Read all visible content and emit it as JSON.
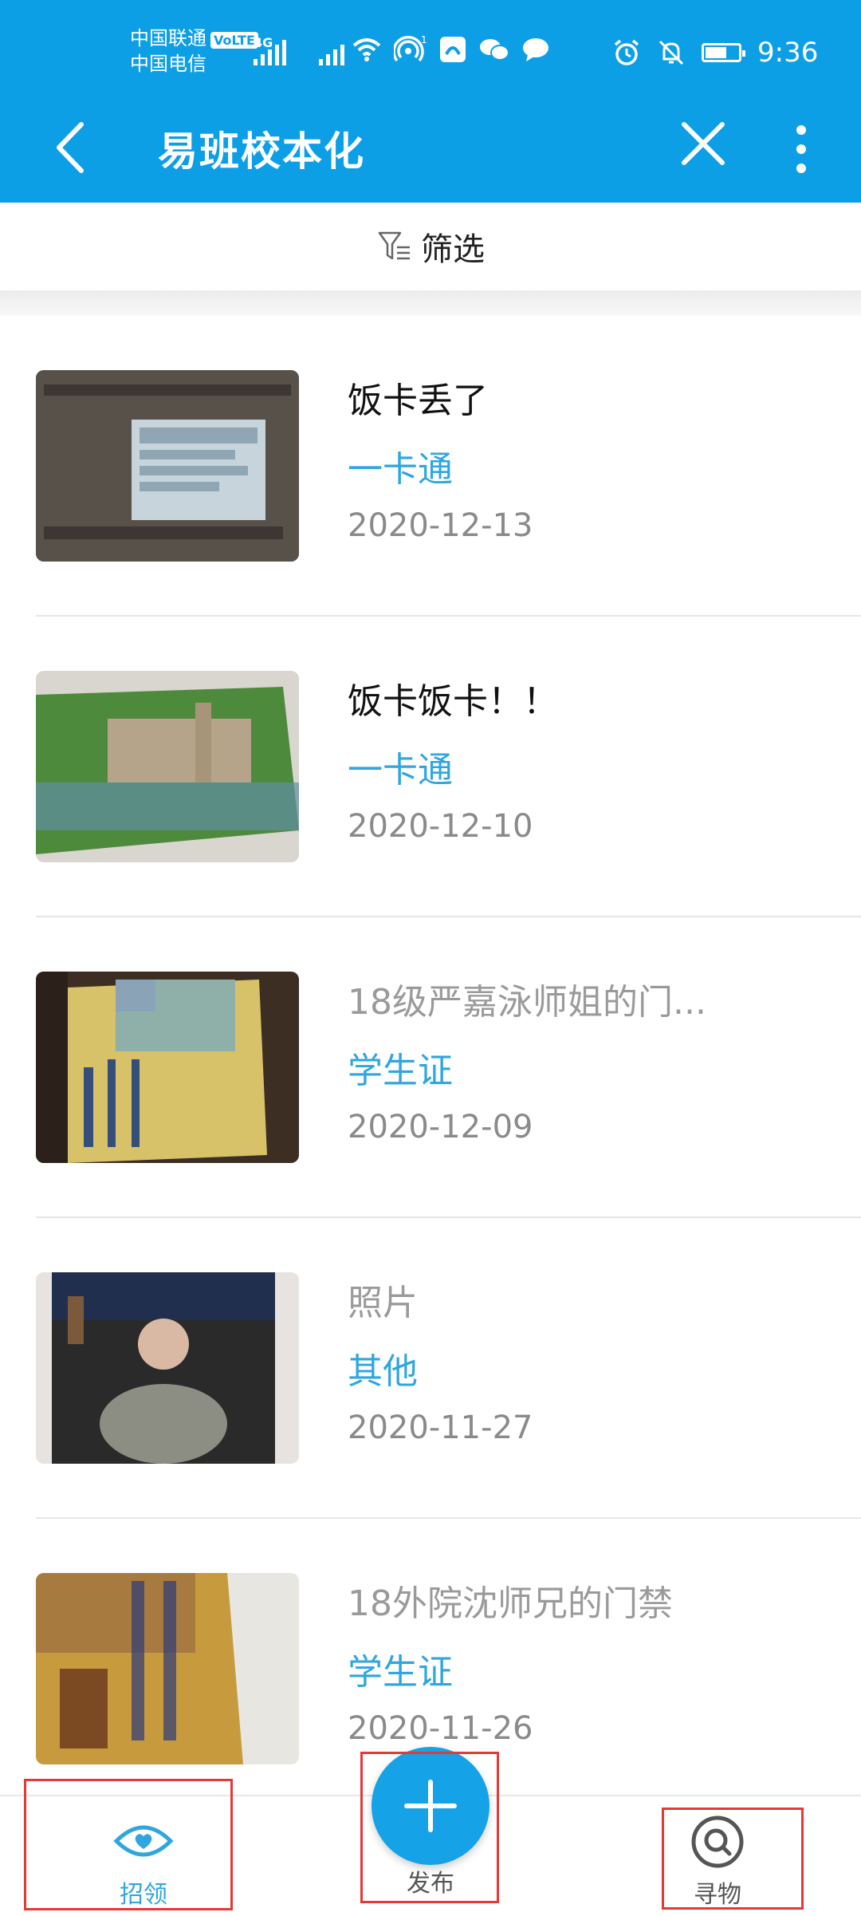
{
  "status_bar": {
    "carrier_1": "中国联通",
    "carrier_2": "中国电信",
    "volte": "VoLTE",
    "network": "4G",
    "hotspot_count": "1",
    "time": "9:36"
  },
  "app_bar": {
    "title": "易班校本化"
  },
  "filter": {
    "label": "筛选"
  },
  "items": [
    {
      "title": "饭卡丢了",
      "category": "一卡通",
      "date": "2020-12-13",
      "title_style": "dark"
    },
    {
      "title": "饭卡饭卡！！",
      "category": "一卡通",
      "date": "2020-12-10",
      "title_style": "dark"
    },
    {
      "title": "18级严嘉泳师姐的门...",
      "category": "学生证",
      "date": "2020-12-09",
      "title_style": "muted"
    },
    {
      "title": "照片",
      "category": "其他",
      "date": "2020-11-27",
      "title_style": "muted"
    },
    {
      "title": "18外院沈师兄的门禁",
      "category": "学生证",
      "date": "2020-11-26",
      "title_style": "muted"
    }
  ],
  "bottom_nav": {
    "claim": "招领",
    "publish": "发布",
    "find": "寻物"
  },
  "colors": {
    "brand_blue": "#0d9fe6",
    "accent_blue": "#2ea6df",
    "highlight_red": "#e53935"
  }
}
